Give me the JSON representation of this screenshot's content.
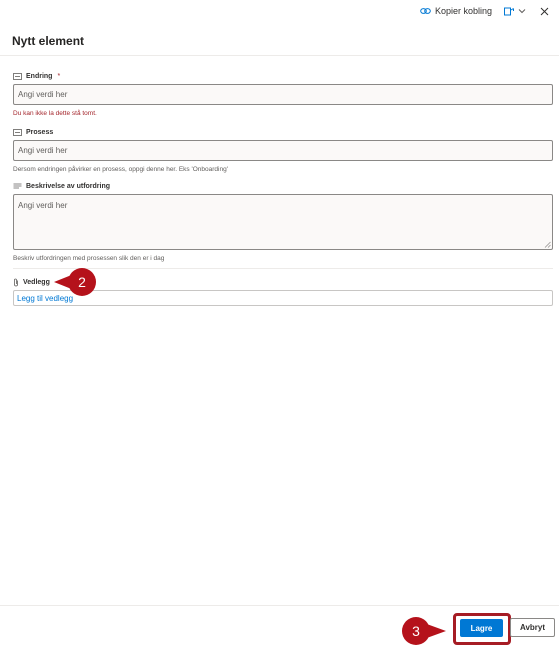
{
  "topbar": {
    "copy_link_label": "Kopier kobling"
  },
  "panel": {
    "title": "Nytt element"
  },
  "fields": {
    "endring": {
      "label": "Endring",
      "required_mark": "*",
      "placeholder": "Angi verdi her",
      "error": "Du kan ikke la dette stå tomt."
    },
    "prosess": {
      "label": "Prosess",
      "placeholder": "Angi verdi her",
      "help": "Dersom endringen påvirker en prosess, oppgi denne her. Eks 'Onboarding'"
    },
    "beskrivelse": {
      "label": "Beskrivelse av utfordring",
      "placeholder": "Angi verdi her",
      "help": "Beskriv utfordringen med prosessen slik den er i dag"
    },
    "vedlegg": {
      "label": "Vedlegg",
      "add_link": "Legg til vedlegg"
    }
  },
  "callouts": {
    "step2": "2",
    "step3": "3"
  },
  "footer": {
    "save_label": "Lagre",
    "cancel_label": "Avbryt"
  },
  "colors": {
    "accent": "#0078d4",
    "error": "#a4262c",
    "callout": "#b5121b"
  }
}
